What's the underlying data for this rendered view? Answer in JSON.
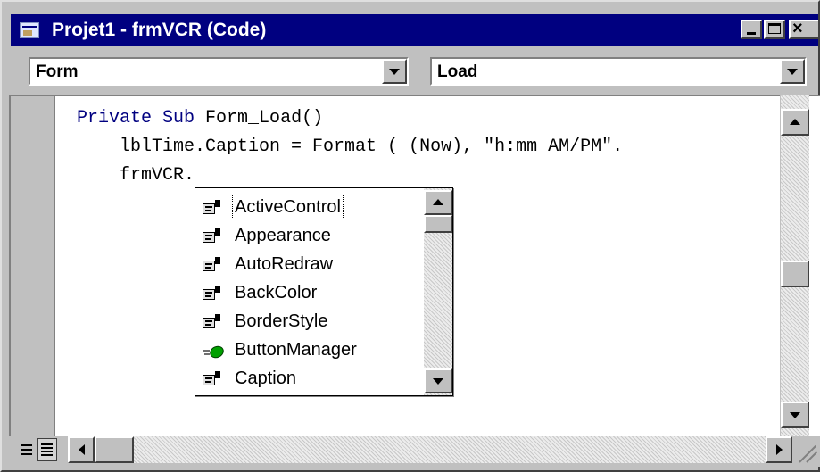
{
  "window": {
    "title": "Projet1 - frmVCR (Code)",
    "close_glyph": "×"
  },
  "object_combo": {
    "value": "Form"
  },
  "procedure_combo": {
    "value": "Load"
  },
  "code": {
    "lines": [
      {
        "keyword1": "Private",
        "keyword2": "Sub",
        "rest": " Form_Load()"
      },
      {
        "text": "    lblTime.Caption = Format ( (Now), \"h:mm AM/PM\"."
      },
      {
        "text": "    frmVCR."
      }
    ]
  },
  "autocomplete": {
    "items": [
      {
        "label": "ActiveControl",
        "icon": "property-icon",
        "selected": true
      },
      {
        "label": "Appearance",
        "icon": "property-icon"
      },
      {
        "label": "AutoRedraw",
        "icon": "property-icon"
      },
      {
        "label": "BackColor",
        "icon": "property-icon"
      },
      {
        "label": "BorderStyle",
        "icon": "property-icon"
      },
      {
        "label": "ButtonManager",
        "icon": "object-icon"
      },
      {
        "label": "Caption",
        "icon": "property-icon"
      }
    ]
  },
  "colors": {
    "titlebar": "#000080",
    "keyword": "#000080",
    "chrome": "#c0c0c0"
  }
}
